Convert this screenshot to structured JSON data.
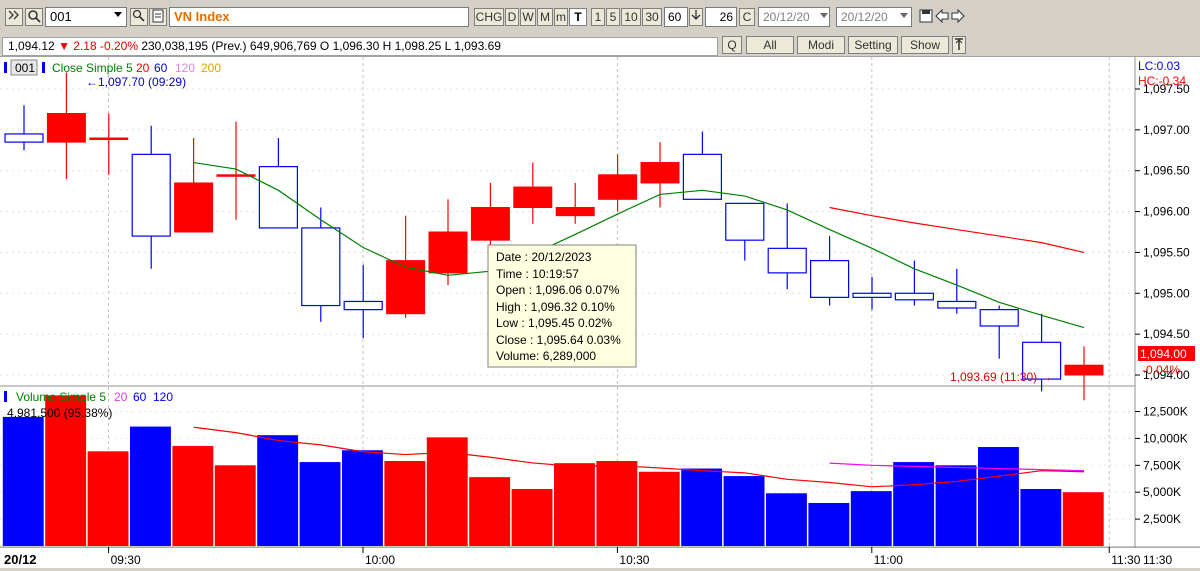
{
  "toolbar": {
    "symbol_code": "001",
    "symbol_name": "VN Index",
    "period_buttons": [
      "CHG",
      "D",
      "W",
      "M",
      "m",
      "T",
      "1",
      "5",
      "10",
      "30"
    ],
    "interval_value": "60",
    "count_value": "26",
    "c_label": "C",
    "date_from": "20/12/20",
    "date_to": "20/12/20"
  },
  "quote": {
    "last": "1,094.12",
    "change": "▼ 2.18 -0.20%",
    "detail": "230,038,195 (Prev.) 649,906,769 O 1,096.30 H 1,098.25 L 1,093.69"
  },
  "actions": {
    "q": "Q",
    "all": "All",
    "modi": "Modi",
    "setting": "Setting",
    "show": "Show"
  },
  "colors": {
    "up": "#ff0000",
    "down": "#0000ff",
    "ma5": "#008000",
    "ma20": "#ff0000",
    "vma20": "#ff00ff"
  },
  "price_legend": {
    "code": "001",
    "title": "Close Simple 5",
    "p20": "20",
    "p60": "60",
    "p120": "120",
    "p200": "200"
  },
  "vol_legend": {
    "title": "Volume Simple 5",
    "p20": "20",
    "p60": "60",
    "p120": "120",
    "value": "4,981,500 (95.38%)"
  },
  "high_marker": "←1,097.70 (09:29)",
  "low_marker": "1,093.69 (11:30) →",
  "lc_label": "LC:0.03",
  "hc_label": "HC:-0.34",
  "last_price_box": "1,094.00",
  "last_change": "-0.04%",
  "date_label": "20/12",
  "tooltip": {
    "date": "Date  : 20/12/2023",
    "time": "Time  : 10:19:57",
    "open": "Open   : 1,096.06   0.07%",
    "high": "High   : 1,096.32   0.10%",
    "low": "Low    : 1,095.45   0.02%",
    "close": "Close : 1,095.64   0.03%",
    "volume": "Volume: 6,289,000"
  },
  "chart_data": {
    "type": "candlestick",
    "price_axis": {
      "min": 1093.3,
      "max": 1097.7,
      "ticks": [
        1097.5,
        1097.0,
        1096.5,
        1096.0,
        1095.5,
        1095.0,
        1094.5,
        1094.0
      ],
      "tick_labels": [
        "1,097.50",
        "1,097.00",
        "1,096.50",
        "1,096.00",
        "1,095.50",
        "1,095.00",
        "1,094.50",
        "1,094.00"
      ]
    },
    "volume_axis": {
      "min": 0,
      "max": 14500000,
      "ticks": [
        12500000,
        10000000,
        7500000,
        5000000,
        2500000
      ],
      "tick_labels": [
        "12,500K",
        "10,000K",
        "7,500K",
        "5,000K",
        "2,500K"
      ]
    },
    "time_labels": [
      "09:30",
      "10:00",
      "10:30",
      "11:00",
      "11:30"
    ],
    "time_label_positions": [
      2,
      8,
      14,
      20,
      25.6
    ],
    "candles": [
      {
        "o": 1096.95,
        "h": 1097.3,
        "l": 1096.75,
        "c": 1096.85
      },
      {
        "o": 1096.85,
        "h": 1097.7,
        "l": 1096.4,
        "c": 1097.2
      },
      {
        "o": 1096.9,
        "h": 1097.2,
        "l": 1096.45,
        "c": 1096.9
      },
      {
        "o": 1096.7,
        "h": 1097.05,
        "l": 1095.3,
        "c": 1095.7
      },
      {
        "o": 1095.75,
        "h": 1096.9,
        "l": 1095.75,
        "c": 1096.35
      },
      {
        "o": 1096.45,
        "h": 1097.1,
        "l": 1095.9,
        "c": 1096.45
      },
      {
        "o": 1096.55,
        "h": 1096.9,
        "l": 1095.8,
        "c": 1095.8
      },
      {
        "o": 1095.8,
        "h": 1096.05,
        "l": 1094.65,
        "c": 1094.85
      },
      {
        "o": 1094.9,
        "h": 1095.35,
        "l": 1094.45,
        "c": 1094.8
      },
      {
        "o": 1094.75,
        "h": 1095.95,
        "l": 1094.7,
        "c": 1095.4
      },
      {
        "o": 1095.25,
        "h": 1096.15,
        "l": 1095.1,
        "c": 1095.75
      },
      {
        "o": 1095.65,
        "h": 1096.35,
        "l": 1095.4,
        "c": 1096.05
      },
      {
        "o": 1096.05,
        "h": 1096.6,
        "l": 1095.85,
        "c": 1096.3
      },
      {
        "o": 1095.95,
        "h": 1096.35,
        "l": 1095.85,
        "c": 1096.05
      },
      {
        "o": 1096.15,
        "h": 1096.7,
        "l": 1096.0,
        "c": 1096.45
      },
      {
        "o": 1096.35,
        "h": 1096.85,
        "l": 1096.05,
        "c": 1096.6
      },
      {
        "o": 1096.7,
        "h": 1096.98,
        "l": 1096.15,
        "c": 1096.15
      },
      {
        "o": 1096.1,
        "h": 1096.1,
        "l": 1095.4,
        "c": 1095.65
      },
      {
        "o": 1095.55,
        "h": 1096.1,
        "l": 1095.05,
        "c": 1095.25
      },
      {
        "o": 1095.4,
        "h": 1095.7,
        "l": 1094.85,
        "c": 1094.95
      },
      {
        "o": 1095.0,
        "h": 1095.2,
        "l": 1094.8,
        "c": 1094.95
      },
      {
        "o": 1095.0,
        "h": 1095.4,
        "l": 1094.85,
        "c": 1094.92
      },
      {
        "o": 1094.9,
        "h": 1095.3,
        "l": 1094.75,
        "c": 1094.82
      },
      {
        "o": 1094.8,
        "h": 1094.85,
        "l": 1094.2,
        "c": 1094.6
      },
      {
        "o": 1094.4,
        "h": 1094.75,
        "l": 1093.8,
        "c": 1093.95
      },
      {
        "o": 1094.0,
        "h": 1094.35,
        "l": 1093.69,
        "c": 1094.12
      }
    ],
    "volumes": [
      12000000,
      14000000,
      8800000,
      11100000,
      9300000,
      7500000,
      10300000,
      7800000,
      8900000,
      7900000,
      10100000,
      6400000,
      5300000,
      7700000,
      7900000,
      6900000,
      7200000,
      6500000,
      4900000,
      4000000,
      5100000,
      7800000,
      7500000,
      9200000,
      5300000,
      5000000
    ],
    "ma5": [
      null,
      null,
      null,
      null,
      1096.6,
      1096.52,
      1096.26,
      1095.9,
      1095.56,
      1095.32,
      1095.22,
      1095.27,
      1095.48,
      1095.72,
      1095.97,
      1096.21,
      1096.26,
      1096.19,
      1096.02,
      1095.78,
      1095.55,
      1095.3,
      1095.1,
      1094.89,
      1094.73,
      1094.58
    ],
    "ma20": [
      null,
      null,
      null,
      null,
      null,
      null,
      null,
      null,
      null,
      null,
      null,
      null,
      null,
      null,
      null,
      null,
      null,
      null,
      null,
      1096.05,
      1095.95,
      1095.86,
      1095.78,
      1095.7,
      1095.62,
      1095.5
    ],
    "vma5": [
      null,
      null,
      null,
      null,
      11040000,
      10540000,
      9800000,
      9400000,
      8760000,
      8500000,
      8700000,
      8250000,
      7720000,
      7400000,
      7480000,
      7250000,
      7000000,
      6800000,
      6200000,
      5900000,
      5500000,
      5700000,
      6000000,
      6500000,
      7000000,
      6900000
    ],
    "vma20": [
      null,
      null,
      null,
      null,
      null,
      null,
      null,
      null,
      null,
      null,
      null,
      null,
      null,
      null,
      null,
      null,
      null,
      null,
      null,
      7700000,
      7500000,
      7400000,
      7300000,
      7200000,
      7100000,
      7000000
    ]
  }
}
